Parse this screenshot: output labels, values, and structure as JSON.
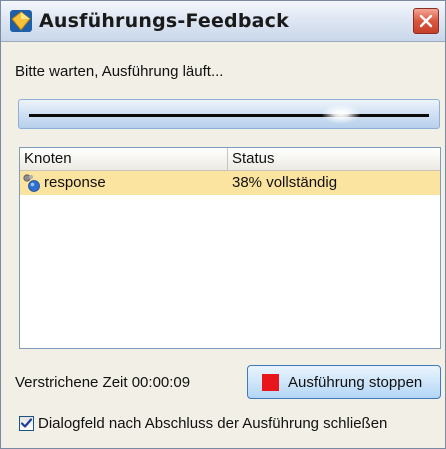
{
  "window": {
    "title": "Ausführungs-Feedback"
  },
  "status": {
    "wait_text": "Bitte warten, Ausführung läuft..."
  },
  "progress": {
    "indeterminate": true,
    "marker_position_fraction": 0.78
  },
  "table": {
    "columns": [
      "Knoten",
      "Status"
    ],
    "rows": [
      {
        "node": "response",
        "status": "38% vollständig",
        "icon": "node-icon",
        "selected": true
      }
    ]
  },
  "footer": {
    "elapsed_text": "Verstrichene Zeit 00:00:09",
    "stop_button_label": "Ausführung stoppen",
    "close_checkbox_label": "Dialogfeld nach Abschluss der Ausführung schließen",
    "close_checkbox_checked": true
  },
  "colors": {
    "selected_row": "#fbe3a0",
    "stop_icon": "#e8161b",
    "close_button": "#d9573f"
  }
}
